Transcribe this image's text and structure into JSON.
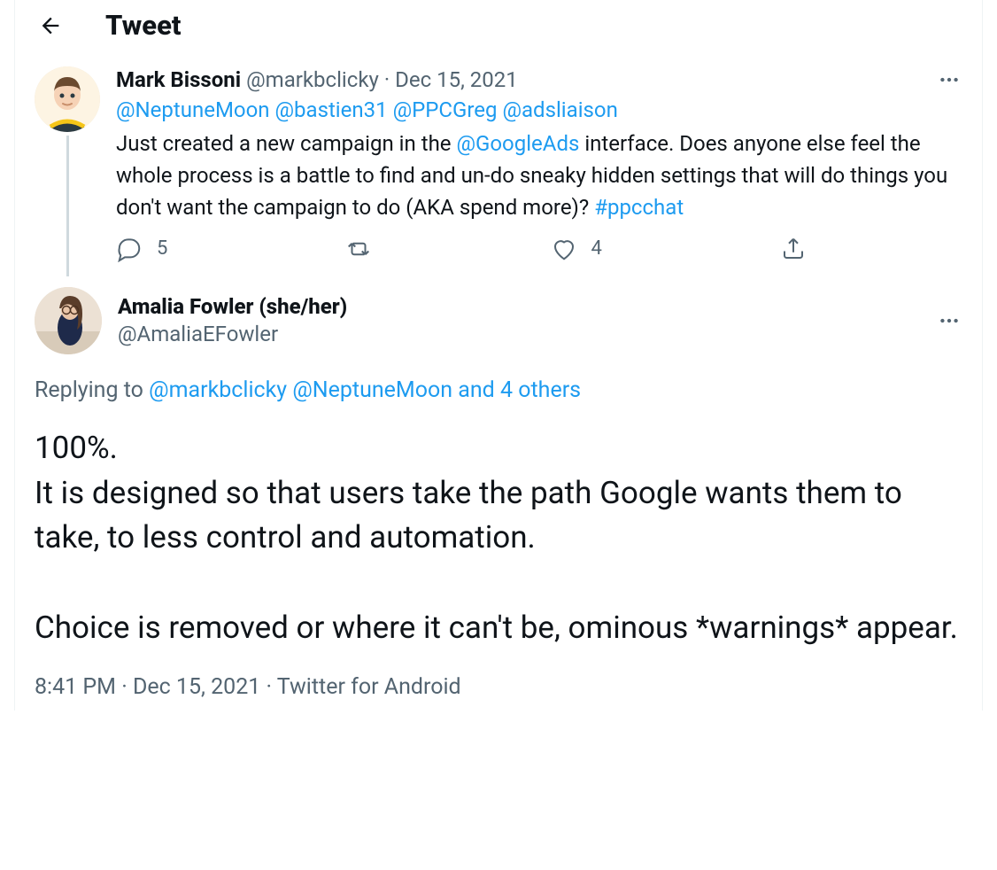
{
  "header": {
    "title": "Tweet"
  },
  "parent": {
    "author": {
      "name": "Mark Bissoni",
      "handle": "@markbclicky"
    },
    "date": "Dec 15, 2021",
    "mentions": [
      "@NeptuneMoon",
      "@bastien31",
      "@PPCGreg",
      "@adsliaison"
    ],
    "text_before": " Just created a new campaign in the ",
    "inline_mention": "@GoogleAds",
    "text_after": " interface. Does anyone else feel the whole process is a battle to find and un-do sneaky hidden settings that will do things you don't want the campaign to do (AKA spend more)? ",
    "hashtag": "#ppcchat",
    "counts": {
      "replies": "5",
      "likes": "4"
    }
  },
  "main": {
    "author": {
      "name": "Amalia Fowler (she/her)",
      "handle": "@AmaliaEFowler"
    },
    "reply_prefix": "Replying to ",
    "reply_to_1": "@markbclicky",
    "reply_to_2": "@NeptuneMoon",
    "reply_to_suffix": " and 4 others",
    "text": "100%.\nIt is designed so that users take the path Google wants them to take, to less control and automation.\n\nChoice is removed or where it can't be, ominous *warnings* appear.",
    "timestamp": "8:41 PM · Dec 15, 2021",
    "source": "Twitter for Android"
  }
}
